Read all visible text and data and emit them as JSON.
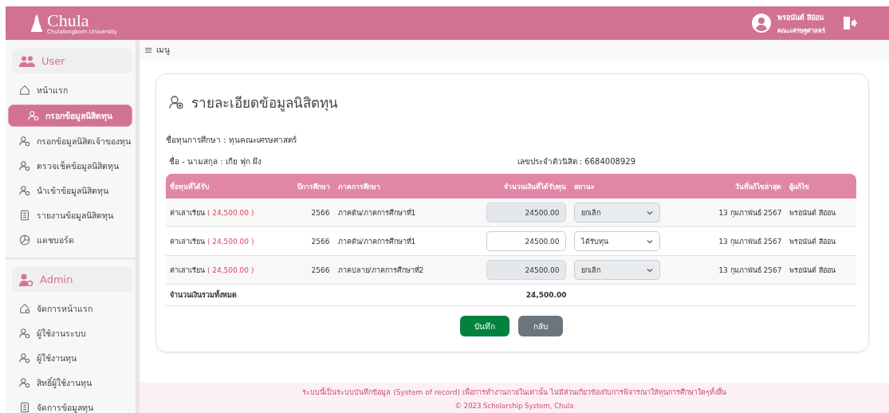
{
  "header": {
    "logo": "Chula",
    "logo_subtitle": "Chulalongkorn University",
    "user_name": "พรอนันต์ สีอ่อน",
    "user_faculty": "คณะเศรษฐศาสตร์"
  },
  "sidebar": {
    "items": [
      {
        "kind": "group",
        "label": "User",
        "selected": false
      },
      {
        "kind": "link",
        "label": "หน้าแรก",
        "selected": false
      },
      {
        "kind": "link",
        "label": "กรอกข้อมูลนิสิตทุน",
        "selected": true
      },
      {
        "kind": "link",
        "label": "กรอกข้อมูลนิสิตเจ้าของทุน",
        "selected": false
      },
      {
        "kind": "link",
        "label": "ตรวจเช็คข้อมูลนิสิตทุน",
        "selected": false
      },
      {
        "kind": "link",
        "label": "นำเข้าข้อมูลนิสิตทุน",
        "selected": false
      },
      {
        "kind": "link",
        "label": "รายงานข้อมูลนิสิตทุน",
        "selected": false
      },
      {
        "kind": "link",
        "label": "แดชบอร์ด",
        "selected": false
      },
      {
        "kind": "group",
        "label": "Admin",
        "selected": false
      },
      {
        "kind": "link",
        "label": "จัดการหน้าแรก",
        "selected": false
      },
      {
        "kind": "link",
        "label": "ผู้ใช้งานระบบ",
        "selected": false
      },
      {
        "kind": "link",
        "label": "ผู้ใช้งานทุน",
        "selected": false
      },
      {
        "kind": "link",
        "label": "สิทธิ์ผู้ใช้งานทุน",
        "selected": false
      },
      {
        "kind": "link",
        "label": "จัดการข้อมูลทุน",
        "selected": false
      }
    ]
  },
  "menu_toggle": {
    "icon": "≡",
    "label": "เมนู"
  },
  "card": {
    "title": "รายละเอียดข้อมูลนิสิตทุน",
    "scholarship": "ชื่อทุนการศึกษา : ทุนคณะเศรษศาสตร์",
    "student_name": "ชื่อ - นามสกุล : เกีย ฟุก ผึง",
    "student_id": "เลขประจำตัวนิสิต : 6684008929",
    "table": {
      "columns": [
        "ชื่อทุนที่ได้รับ",
        "ปีการศึกษา",
        "ภาคการศึกษา",
        "จำนวนเงินที่ได้รับทุน",
        "สถานะ",
        "วันที่แก้ไขล่าสุด",
        "ผู้แก้ไข"
      ],
      "rows": [
        {
          "name": "ค่าเล่าเรียน",
          "amount_note": "( 24,500.00 )",
          "year": "2566",
          "term": "ภาคต้น/ภาคการศึกษาที่1",
          "amount": "24500.00",
          "disabled": true,
          "status": "ยกเลิก",
          "date": "13 กุมภาพันธ์ 2567",
          "editor": "พรอนันต์ สีอ่อน"
        },
        {
          "name": "ค่าเล่าเรียน",
          "amount_note": "( 24,500.00 )",
          "year": "2566",
          "term": "ภาคต้น/ภาคการศึกษาที่1",
          "amount": "24500.00",
          "disabled": false,
          "status": "ได้รับทุน",
          "date": "13 กุมภาพันธ์ 2567",
          "editor": "พรอนันต์ สีอ่อน"
        },
        {
          "name": "ค่าเล่าเรียน",
          "amount_note": "( 24,500.00 )",
          "year": "2566",
          "term": "ภาคปลาย/ภาคการศึกษาที่2",
          "amount": "24500.00",
          "disabled": true,
          "status": "ยกเลิก",
          "date": "13 กุมภาพันธ์ 2567",
          "editor": "พรอนันต์ สีอ่อน"
        }
      ],
      "total_label": "จำนวนเงินรวมทั้งหมด",
      "total": "24,500.00"
    },
    "buttons": [
      {
        "kind": "primary",
        "label": "บันทึก"
      },
      {
        "kind": "secondary",
        "label": "กลับ"
      }
    ]
  },
  "footer": {
    "notice": "ระบบนี้เป็นระบบบันทึกข้อมูล (System of record) เพื่อการทำงานภายในเท่านั้น ไม่มีส่วนเกี่ยวข้องกับการพิจารณาให้ทุนการศึกษาใดๆทั้งสิ้น",
    "copyright": "© 2023 Scholarship System, Chula"
  }
}
